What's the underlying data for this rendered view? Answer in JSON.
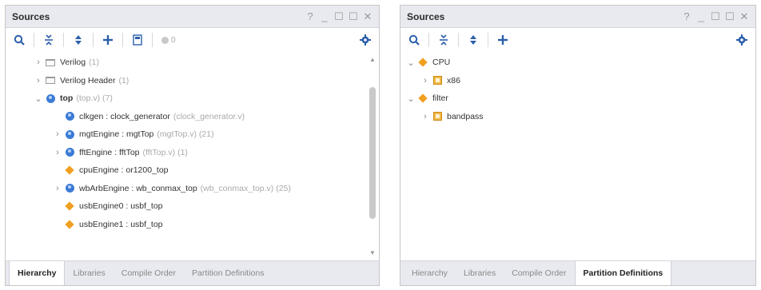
{
  "left_panel": {
    "title": "Sources",
    "window_controls": [
      "?",
      "_",
      "☐",
      "☐",
      "✕"
    ],
    "badge_count": "0",
    "tree": [
      {
        "indent": 1,
        "arrow": "›",
        "icon": "folder",
        "label": "Verilog",
        "suffix": "(1)",
        "bold": false
      },
      {
        "indent": 1,
        "arrow": "›",
        "icon": "folder",
        "label": "Verilog Header",
        "suffix": "(1)",
        "bold": false
      },
      {
        "indent": 1,
        "arrow": "⌄",
        "icon": "module-top",
        "label": "top",
        "suffix": "(top.v) (7)",
        "bold": true
      },
      {
        "indent": 2,
        "arrow": "",
        "icon": "module",
        "label": "clkgen : clock_generator",
        "suffix": "(clock_generator.v)",
        "bold": false
      },
      {
        "indent": 2,
        "arrow": "›",
        "icon": "module",
        "label": "mgtEngine : mgtTop",
        "suffix": "(mgtTop.v) (21)",
        "bold": false
      },
      {
        "indent": 2,
        "arrow": "›",
        "icon": "module",
        "label": "fftEngine : fftTop",
        "suffix": "(fftTop.v) (1)",
        "bold": false
      },
      {
        "indent": 2,
        "arrow": "",
        "icon": "diamond",
        "label": "cpuEngine : or1200_top",
        "suffix": "",
        "bold": false
      },
      {
        "indent": 2,
        "arrow": "›",
        "icon": "module",
        "label": "wbArbEngine : wb_conmax_top",
        "suffix": "(wb_conmax_top.v) (25)",
        "bold": false
      },
      {
        "indent": 2,
        "arrow": "",
        "icon": "diamond",
        "label": "usbEngine0 : usbf_top",
        "suffix": "",
        "bold": false
      },
      {
        "indent": 2,
        "arrow": "",
        "icon": "diamond",
        "label": "usbEngine1 : usbf_top",
        "suffix": "",
        "bold": false
      }
    ],
    "tabs": [
      "Hierarchy",
      "Libraries",
      "Compile Order",
      "Partition Definitions"
    ],
    "active_tab": 0
  },
  "right_panel": {
    "title": "Sources",
    "window_controls": [
      "?",
      "_",
      "☐",
      "☐",
      "✕"
    ],
    "tree": [
      {
        "indent": 0,
        "arrow": "⌄",
        "icon": "diamond",
        "label": "CPU",
        "suffix": ""
      },
      {
        "indent": 1,
        "arrow": "›",
        "icon": "chip",
        "label": "x86",
        "suffix": ""
      },
      {
        "indent": 0,
        "arrow": "⌄",
        "icon": "diamond",
        "label": "filter",
        "suffix": ""
      },
      {
        "indent": 1,
        "arrow": "›",
        "icon": "chip",
        "label": "bandpass",
        "suffix": ""
      }
    ],
    "tabs": [
      "Hierarchy",
      "Libraries",
      "Compile Order",
      "Partition Definitions"
    ],
    "active_tab": 3
  },
  "colors": {
    "accent_blue": "#3a7bd5",
    "diamond_orange": "#f0a020",
    "titlebar_bg": "#e9eaf0"
  }
}
